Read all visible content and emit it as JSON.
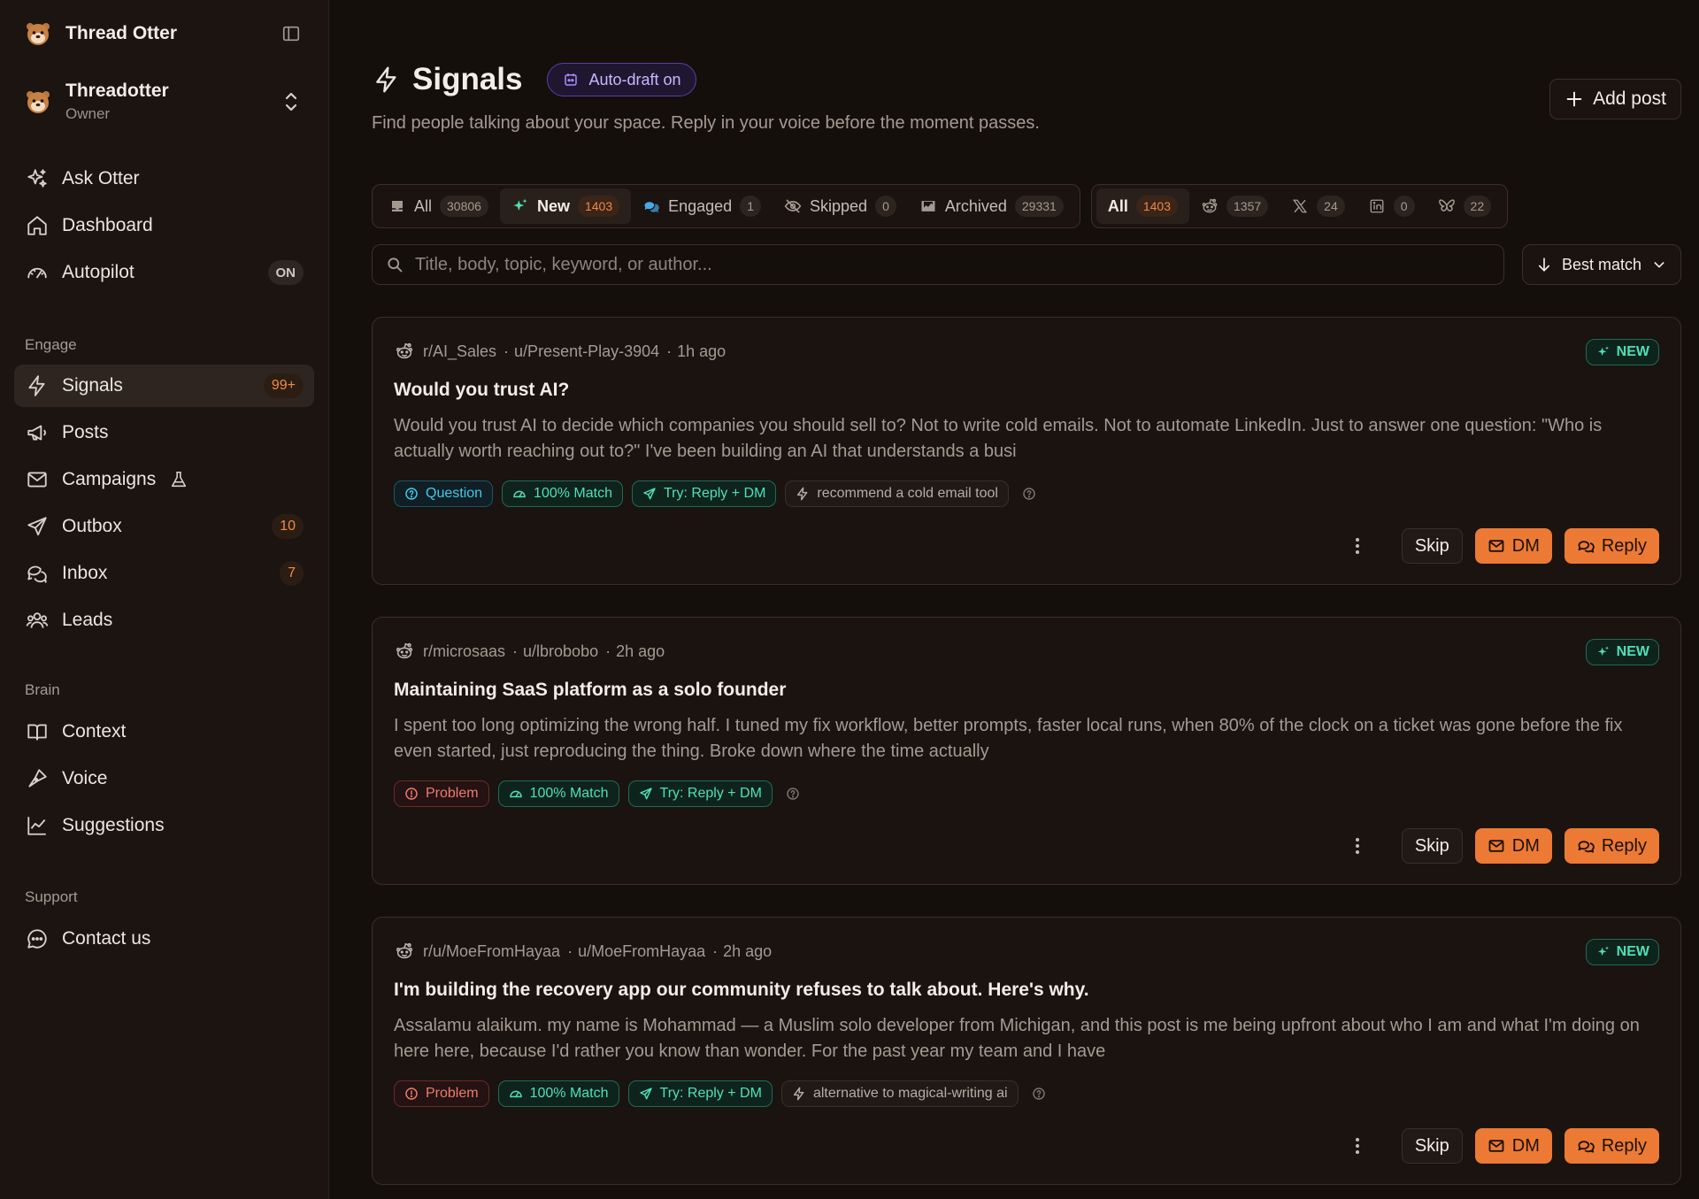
{
  "app": {
    "name": "Thread Otter"
  },
  "account": {
    "name": "Threadotter",
    "role": "Owner"
  },
  "nav_top": [
    {
      "label": "Ask Otter",
      "icon": "sparkle-icon"
    },
    {
      "label": "Dashboard",
      "icon": "home-icon"
    },
    {
      "label": "Autopilot",
      "icon": "gauge-icon",
      "badge": "ON"
    }
  ],
  "sections": {
    "engage": "Engage",
    "brain": "Brain",
    "support": "Support"
  },
  "nav_engage": [
    {
      "label": "Signals",
      "badge": "99+",
      "active": true
    },
    {
      "label": "Posts"
    },
    {
      "label": "Campaigns"
    },
    {
      "label": "Outbox",
      "badge": "10"
    },
    {
      "label": "Inbox",
      "badge": "7"
    },
    {
      "label": "Leads"
    }
  ],
  "nav_brain": [
    {
      "label": "Context"
    },
    {
      "label": "Voice"
    },
    {
      "label": "Suggestions"
    }
  ],
  "nav_support": [
    {
      "label": "Contact us"
    }
  ],
  "page": {
    "title": "Signals",
    "autodraft": "Auto-draft on",
    "subtitle": "Find people talking about your space. Reply in your voice before the moment passes.",
    "add_post": "Add post"
  },
  "status_filters": [
    {
      "label": "All",
      "count": "30806"
    },
    {
      "label": "New",
      "count": "1403",
      "active": true
    },
    {
      "label": "Engaged",
      "count": "1"
    },
    {
      "label": "Skipped",
      "count": "0"
    },
    {
      "label": "Archived",
      "count": "29331"
    }
  ],
  "platform_filters": [
    {
      "label": "All",
      "count": "1403",
      "active": true
    },
    {
      "platform": "reddit",
      "count": "1357"
    },
    {
      "platform": "x",
      "count": "24"
    },
    {
      "platform": "linkedin",
      "count": "0"
    },
    {
      "platform": "bluesky",
      "count": "22"
    }
  ],
  "search": {
    "placeholder": "Title, body, topic, keyword, or author..."
  },
  "sort": {
    "label": "Best match"
  },
  "labels": {
    "new": "NEW",
    "skip": "Skip",
    "dm": "DM",
    "reply": "Reply"
  },
  "posts": [
    {
      "subreddit": "r/AI_Sales",
      "author": "u/Present-Play-3904",
      "time": "1h ago",
      "title": "Would you trust AI?",
      "body": "Would you trust AI to decide which companies you should sell to? Not to write cold emails. Not to automate LinkedIn. Just to answer one question: \"Who is actually worth reaching out to?\" I've been building an AI that understands a busi",
      "tags": [
        {
          "kind": "question",
          "label": "Question"
        },
        {
          "kind": "match",
          "label": "100% Match"
        },
        {
          "kind": "try",
          "label": "Try: Reply + DM"
        },
        {
          "kind": "keyword",
          "label": "recommend a cold email tool"
        }
      ]
    },
    {
      "subreddit": "r/microsaas",
      "author": "u/lbrobobo",
      "time": "2h ago",
      "title": "Maintaining SaaS platform as a solo founder",
      "body": "I spent too long optimizing the wrong half. I tuned my fix workflow, better prompts, faster local runs, when 80% of the clock on a ticket was gone before the fix even started, just reproducing the thing. Broke down where the time actually",
      "tags": [
        {
          "kind": "problem",
          "label": "Problem"
        },
        {
          "kind": "match",
          "label": "100% Match"
        },
        {
          "kind": "try",
          "label": "Try: Reply + DM"
        }
      ]
    },
    {
      "subreddit": "r/u/MoeFromHayaa",
      "author": "u/MoeFromHayaa",
      "time": "2h ago",
      "title": "I'm building the recovery app our community refuses to talk about. Here's why.",
      "body": "Assalamu alaikum. my name is Mohammad — a Muslim solo developer from Michigan, and this post is me being upfront about who I am and what I'm doing on here here, because I'd rather you know than wonder. For the past year my team and I have",
      "tags": [
        {
          "kind": "problem",
          "label": "Problem"
        },
        {
          "kind": "match",
          "label": "100% Match"
        },
        {
          "kind": "try",
          "label": "Try: Reply + DM"
        },
        {
          "kind": "keyword",
          "label": "alternative to magical-writing ai"
        }
      ]
    }
  ],
  "colors": {
    "accent": "#ec7a35",
    "success": "#4fe0b5",
    "background": "#150f0c",
    "sidebar": "#1b1411"
  }
}
